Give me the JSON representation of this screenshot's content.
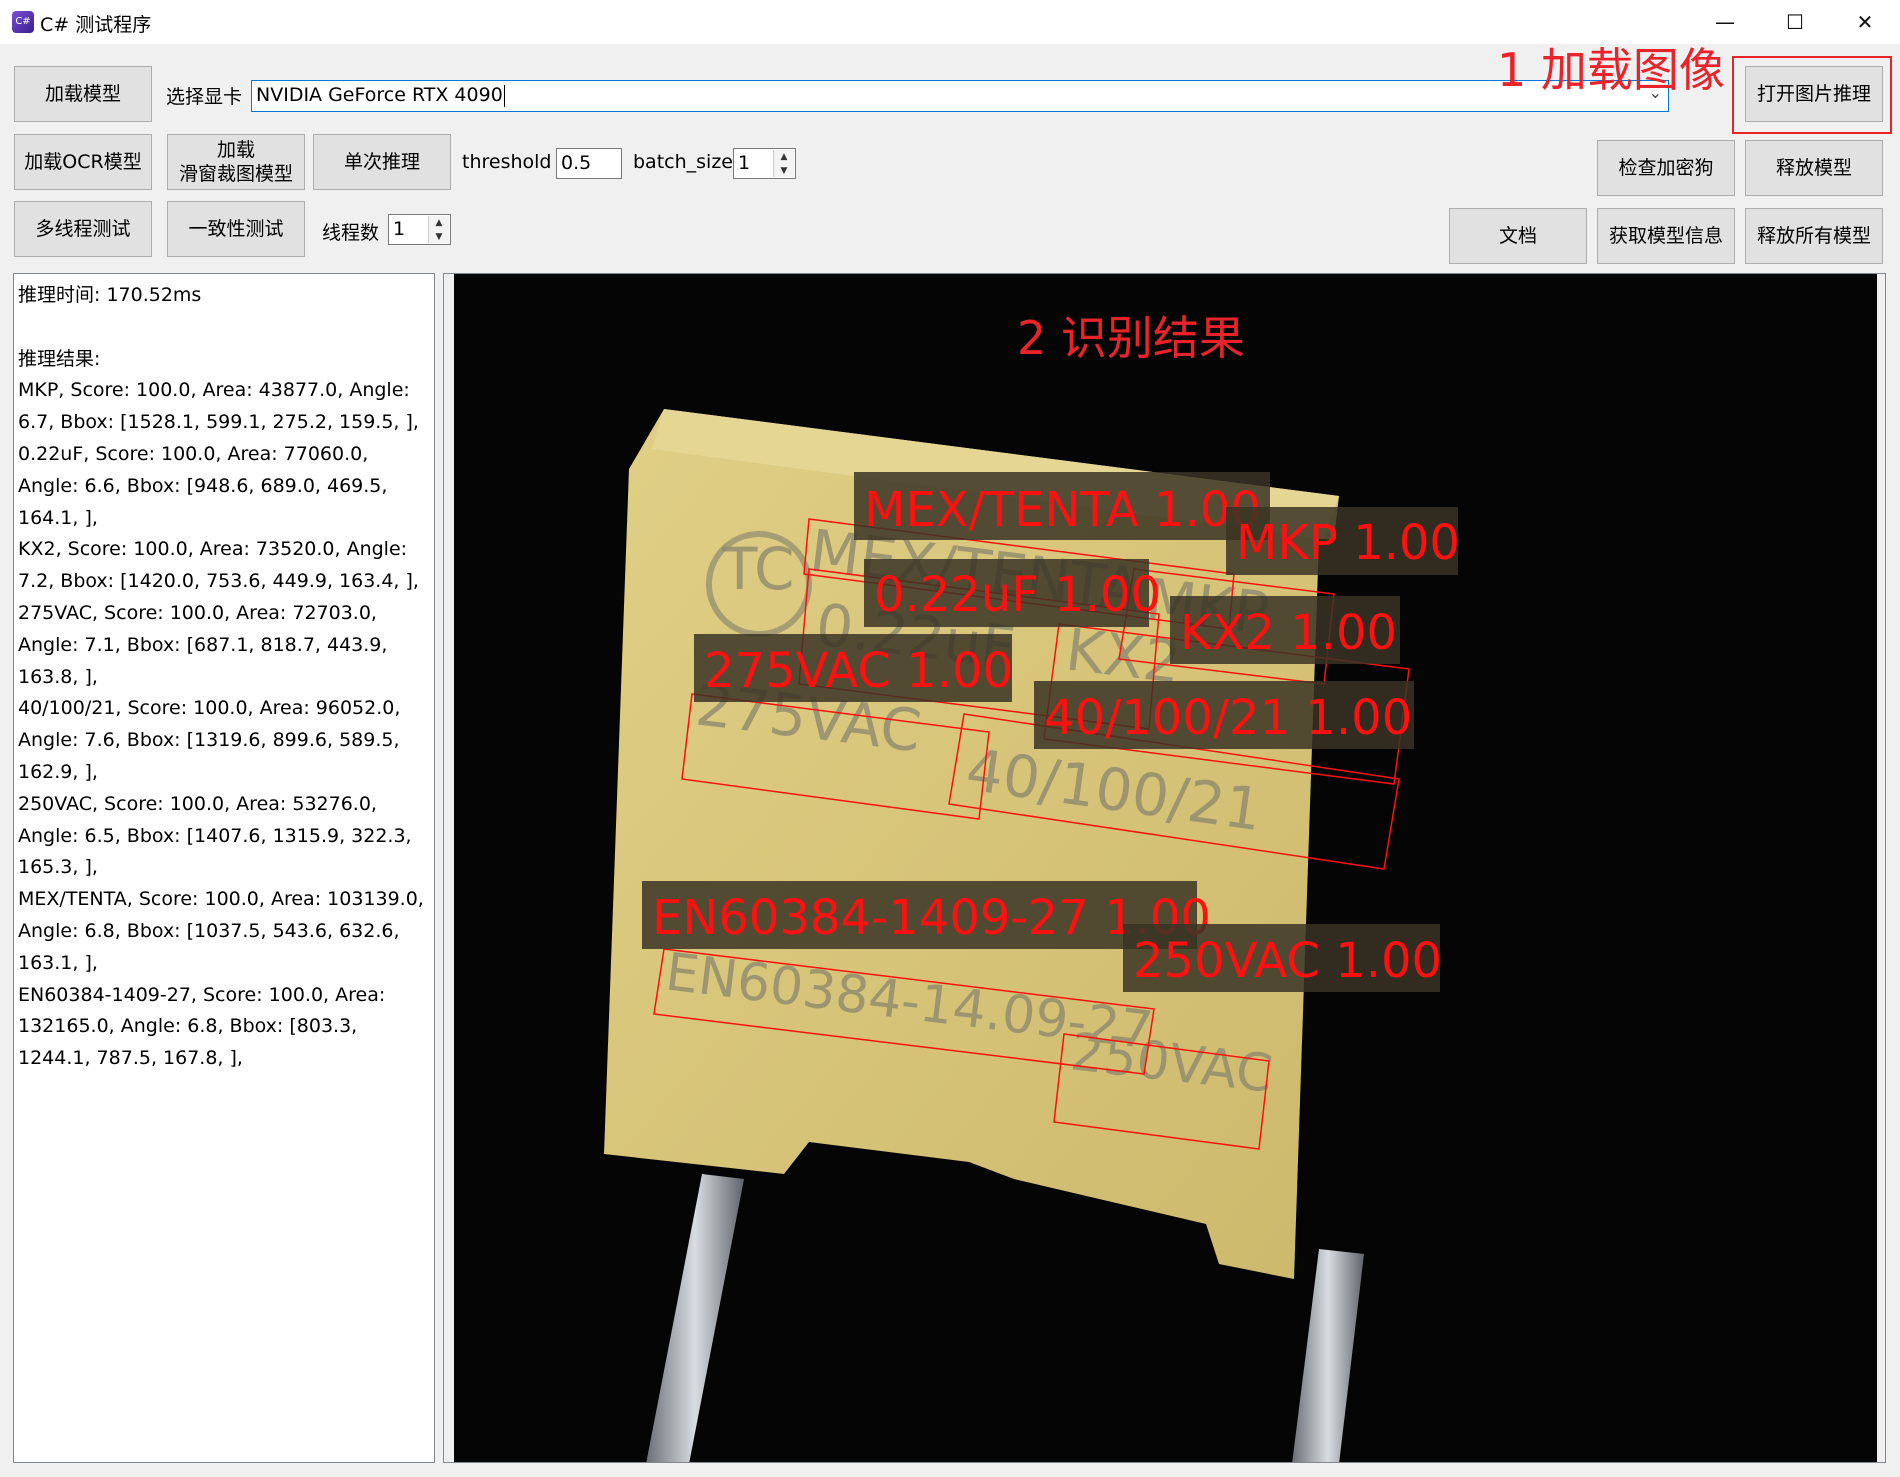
{
  "window": {
    "title": "C# 测试程序",
    "icon_text": "C#"
  },
  "toolbar": {
    "load_model": "加载模型",
    "select_gpu_label": "选择显卡",
    "gpu_value": "NVIDIA GeForce RTX 4090",
    "open_image_infer": "打开图片推理",
    "load_ocr_model": "加载OCR模型",
    "load_sliding_line1": "加载",
    "load_sliding_line2": "滑窗裁图模型",
    "single_infer": "单次推理",
    "threshold_label": "threshold",
    "threshold_value": "0.5",
    "batch_size_label": "batch_size",
    "batch_size_value": "1",
    "check_dongle": "检查加密狗",
    "release_model": "释放模型",
    "multithread_test": "多线程测试",
    "consistency_test": "一致性测试",
    "thread_count_label": "线程数",
    "thread_count_value": "1",
    "docs": "文档",
    "get_model_info": "获取模型信息",
    "release_all_models": "释放所有模型"
  },
  "annotations": {
    "step1": "1 加载图像",
    "step2": "2 识别结果"
  },
  "results": {
    "text": "推理时间: 170.52ms\n\n推理结果:\nMKP, Score: 100.0, Area: 43877.0, Angle: 6.7, Bbox: [1528.1, 599.1, 275.2, 159.5, ],\n0.22uF, Score: 100.0, Area: 77060.0, Angle: 6.6, Bbox: [948.6, 689.0, 469.5, 164.1, ],\nKX2, Score: 100.0, Area: 73520.0, Angle: 7.2, Bbox: [1420.0, 753.6, 449.9, 163.4, ],\n275VAC, Score: 100.0, Area: 72703.0, Angle: 7.1, Bbox: [687.1, 818.7, 443.9, 163.8, ],\n40/100/21, Score: 100.0, Area: 96052.0, Angle: 7.6, Bbox: [1319.6, 899.6, 589.5, 162.9, ],\n250VAC, Score: 100.0, Area: 53276.0, Angle: 6.5, Bbox: [1407.6, 1315.9, 322.3, 165.3, ],\nMEX/TENTA, Score: 100.0, Area: 103139.0, Angle: 6.8, Bbox: [1037.5, 543.6, 632.6, 163.1, ],\nEN60384-1409-27, Score: 100.0, Area: 132165.0, Angle: 6.8, Bbox: [803.3, 1244.1, 787.5, 167.8, ],"
  },
  "detections": [
    {
      "label": "MEX/TENTA 1.00"
    },
    {
      "label": "MKP 1.00"
    },
    {
      "label": "0.22uF 1.00"
    },
    {
      "label": "KX2 1.00"
    },
    {
      "label": "275VAC 1.00"
    },
    {
      "label": "40/100/21 1.00"
    },
    {
      "label": "EN60384-1409-27 1.00"
    },
    {
      "label": "250VAC 1.00"
    }
  ],
  "printed_text": {
    "tc": "TC",
    "mex": "MEX/TENTA",
    "mkp": "MKP",
    "cap": "0.22uF",
    "kx2": "KX2",
    "v275": "275VAC",
    "date": "40/100/21",
    "en": "EN60384-14.09-27",
    "v250": "250VAC"
  },
  "colors": {
    "annotation_red": "#e8232a",
    "capacitor_yellow": "#d9c77a",
    "background": "#050505"
  }
}
